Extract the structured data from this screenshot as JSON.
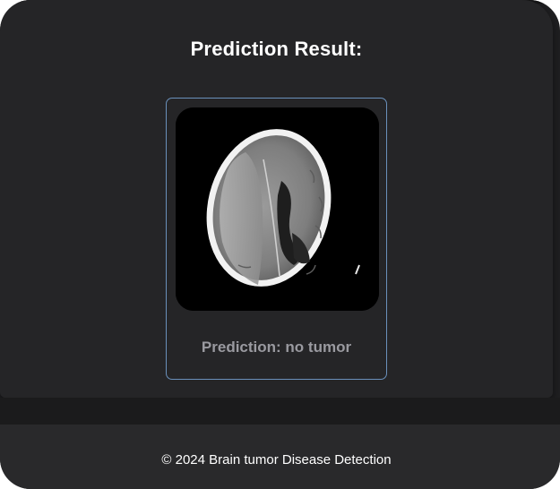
{
  "result": {
    "heading": "Prediction Result:",
    "prediction_text": "Prediction: no tumor",
    "scan_image": "brain-ct-scan"
  },
  "footer": {
    "text": "© 2024 Brain tumor Disease Detection"
  },
  "colors": {
    "page_background": "#1f1f21",
    "panel_background": "#252527",
    "card_border": "#6a90bb",
    "prediction_text": "#9a9aa0",
    "footer_background": "#29292b"
  }
}
